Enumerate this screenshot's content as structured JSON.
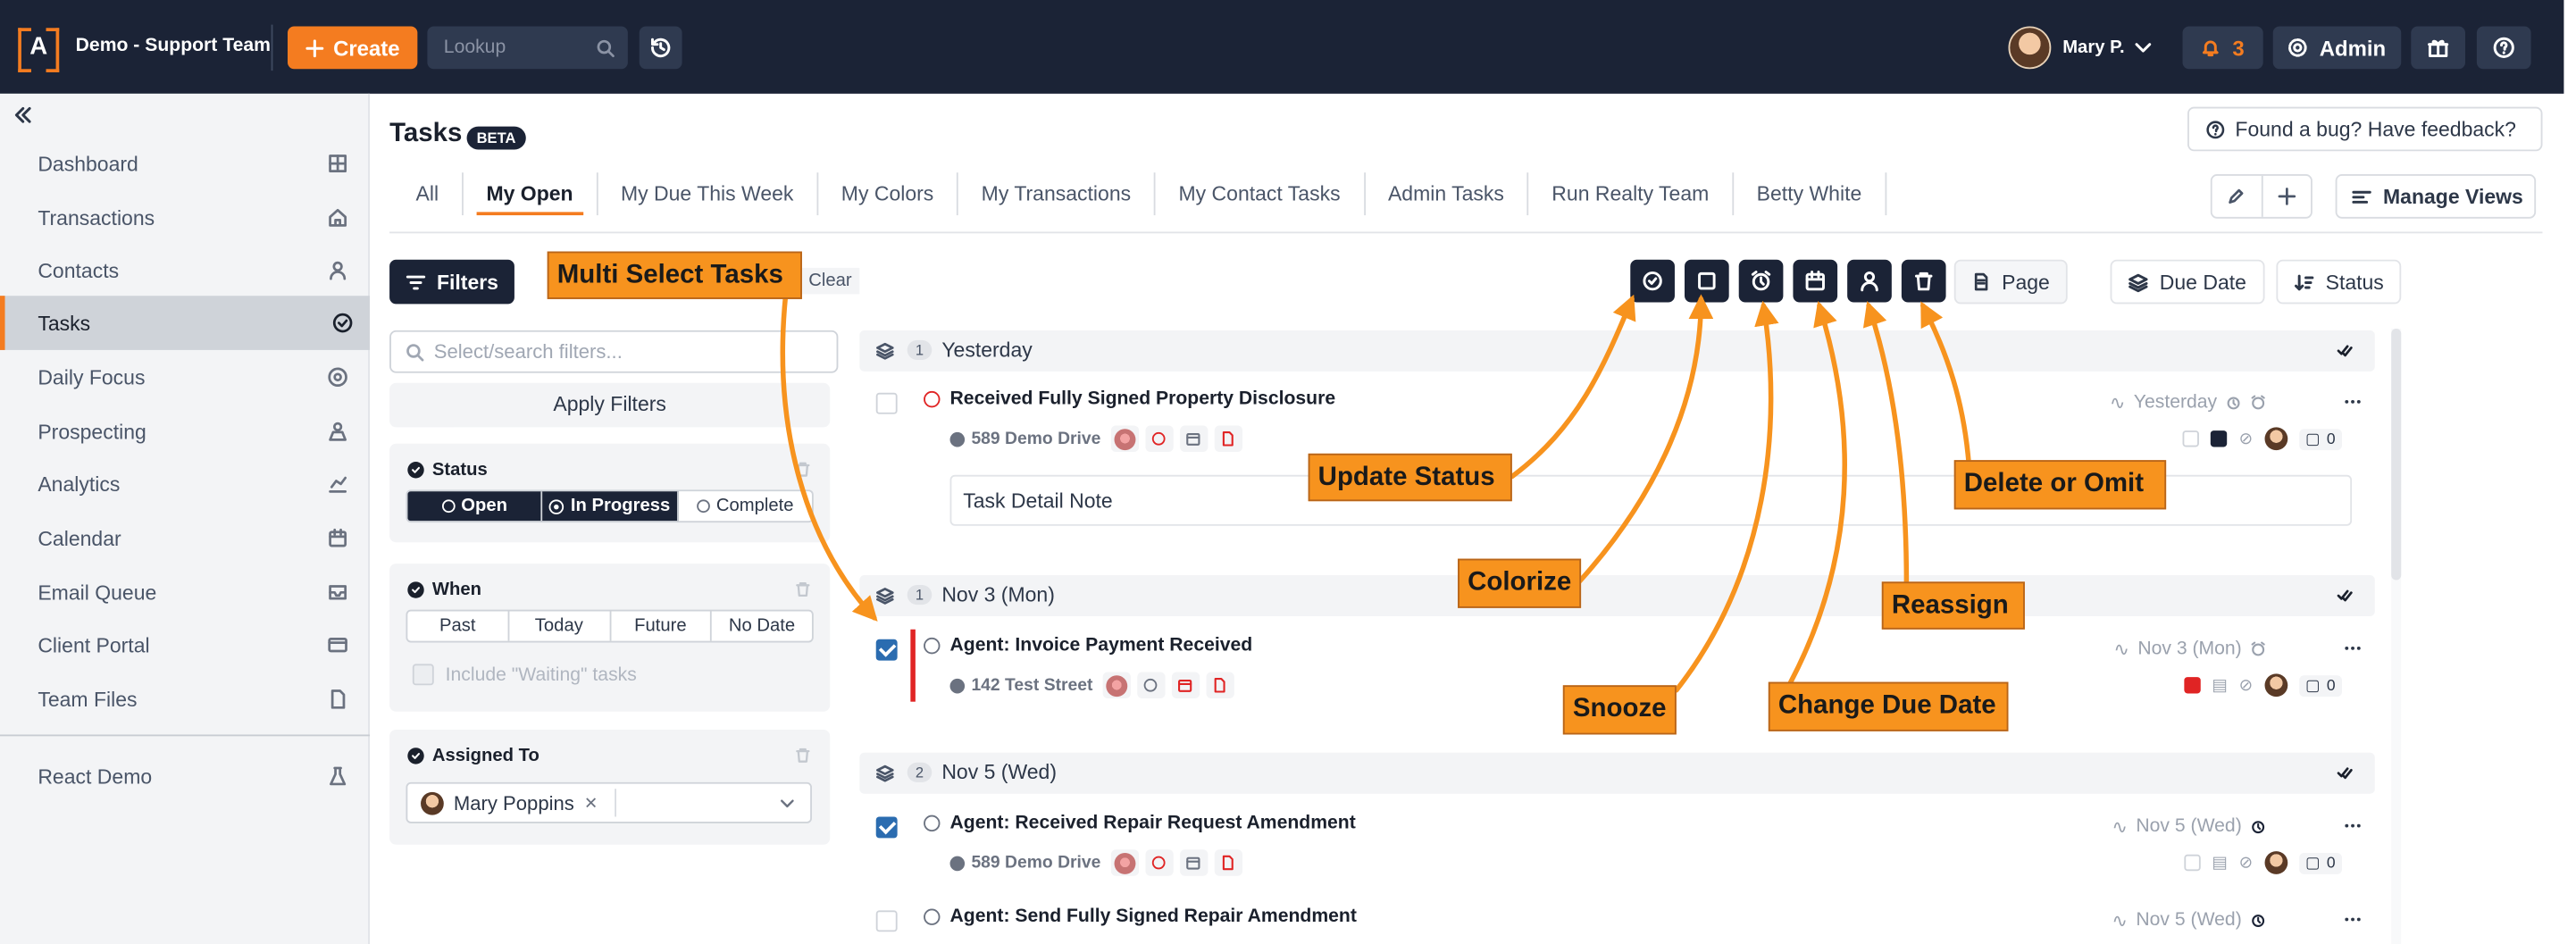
{
  "topbar": {
    "org": "Demo - Support Team",
    "create_label": "Create",
    "lookup_placeholder": "Lookup",
    "user_name": "Mary P.",
    "notif_count": "3",
    "admin_label": "Admin"
  },
  "sidebar": {
    "items": [
      {
        "label": "Dashboard",
        "icon": "grid-icon"
      },
      {
        "label": "Transactions",
        "icon": "home-icon"
      },
      {
        "label": "Contacts",
        "icon": "user-icon"
      },
      {
        "label": "Tasks",
        "icon": "check-circle-icon"
      },
      {
        "label": "Daily Focus",
        "icon": "target-icon"
      },
      {
        "label": "Prospecting",
        "icon": "users-icon"
      },
      {
        "label": "Analytics",
        "icon": "chart-icon"
      },
      {
        "label": "Calendar",
        "icon": "calendar-icon"
      },
      {
        "label": "Email Queue",
        "icon": "inbox-icon"
      },
      {
        "label": "Client Portal",
        "icon": "card-icon"
      },
      {
        "label": "Team Files",
        "icon": "file-icon"
      }
    ],
    "demo": "React Demo"
  },
  "page": {
    "title": "Tasks",
    "badge": "BETA",
    "feedback": "Found a bug? Have feedback?",
    "manage_views": "Manage Views"
  },
  "tabs": [
    "All",
    "My Open",
    "My Due This Week",
    "My Colors",
    "My Transactions",
    "My Contact Tasks",
    "Admin Tasks",
    "Run Realty Team",
    "Betty White"
  ],
  "toolbar": {
    "filters": "Filters",
    "clear": "Clear",
    "page": "Page",
    "due_date": "Due Date",
    "status": "Status"
  },
  "filters": {
    "search_placeholder": "Select/search filters...",
    "apply": "Apply Filters",
    "status": {
      "title": "Status",
      "options": [
        "Open",
        "In Progress",
        "Complete"
      ]
    },
    "when": {
      "title": "When",
      "options": [
        "Past",
        "Today",
        "Future",
        "No Date"
      ],
      "waiting": "Include \"Waiting\" tasks"
    },
    "assigned": {
      "title": "Assigned To",
      "value": "Mary Poppins"
    }
  },
  "groups": [
    {
      "count": "1",
      "label": "Yesterday"
    },
    {
      "count": "1",
      "label": "Nov 3 (Mon)"
    },
    {
      "count": "2",
      "label": "Nov 5 (Wed)"
    }
  ],
  "tasks": [
    {
      "title": "Received Fully Signed Property Disclosure",
      "address": "589 Demo Drive",
      "due": "Yesterday",
      "comments": "0",
      "note": "Task Detail Note"
    },
    {
      "title": "Agent: Invoice Payment Received",
      "address": "142 Test Street",
      "due": "Nov 3 (Mon)",
      "comments": "0"
    },
    {
      "title": "Agent: Received Repair Request Amendment",
      "address": "589 Demo Drive",
      "due": "Nov 5 (Wed)",
      "comments": "0"
    },
    {
      "title": "Agent: Send Fully Signed Repair Amendment",
      "due": "Nov 5 (Wed)"
    }
  ],
  "annotations": {
    "multi": "Multi Select Tasks",
    "status": "Update Status",
    "colorize": "Colorize",
    "snooze": "Snooze",
    "due": "Change Due Date",
    "reassign": "Reassign",
    "delete": "Delete or Omit"
  },
  "colors": {
    "brand": "#f47c20",
    "nav": "#1b2336",
    "annotation": "#f7931e",
    "selected_color": "#e02424"
  }
}
